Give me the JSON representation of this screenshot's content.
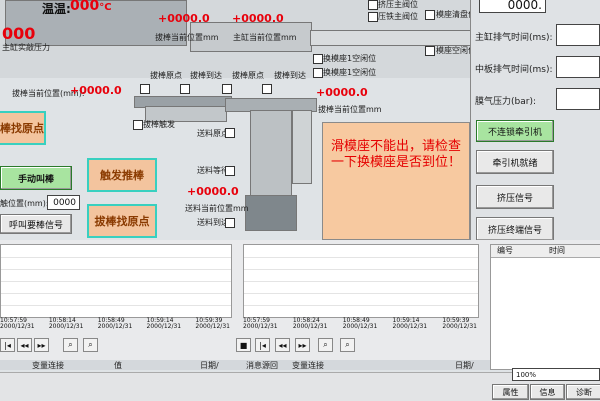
{
  "top": {
    "temp_label": "温温:",
    "temp_value": "000",
    "temp_unit": "°C",
    "red_000": "000",
    "val_a": "+0000.0",
    "val_b": "+0000.0",
    "label_pos_a": "拔棒当前位置mm",
    "label_pos_b": "主缸当前位置mm",
    "label_main_cyl": "主缸实敲压力",
    "chk1": "挤压主阀位",
    "chk2": "压铁主阀位",
    "chk3": "模座清盘位",
    "chk4": "模座空闲位",
    "chk5": "换模座1空闲位",
    "chk6": "换模座1空闲位",
    "top_right_value": "0000."
  },
  "mid": {
    "pos_label": "拔棒当前位置(mm):",
    "pos_value": "+0000.0",
    "lbl_origin": "拔棒原点",
    "lbl_arrive": "拔棒到达",
    "lbl_origin2": "拔棒原点",
    "lbl_arrive2": "拔棒到达",
    "lbl_touch": "拔棒触发",
    "lbl_feed_origin": "送料原点",
    "lbl_feed_wait": "送料等待",
    "lbl_feed_arrive": "送料到达",
    "feed_pos_value": "+0000.0",
    "feed_pos_label": "送料当前位置mm",
    "ext_value": "+0000.0",
    "ext_label": "拔棒当前位置mm"
  },
  "left_buttons": {
    "find_origin_top": "棒找原点",
    "manual": "手动叫棒",
    "pos_label": "触位置(mm):",
    "pos_value": "0000",
    "call_btn": "呼叫要棒信号",
    "trigger": "触发推棒",
    "find_origin": "拔棒找原点"
  },
  "alarm": {
    "text": "滑模座不能出，请检查一下换模座是否到位！"
  },
  "right": {
    "r1_label": "主缸排气时间(ms):",
    "r2_label": "中板排气时间(ms):",
    "r3_label": "膜气压力(bar):",
    "btn_no_link": "不连锁牵引机",
    "btn_ready": "牵引机就绪",
    "btn_signal": "挤压信号",
    "btn_end": "挤压终端信号"
  },
  "charts": {
    "left_times": [
      "10:57:59\n2000/12/31",
      "10:58:14\n2000/12/31",
      "10:58:49\n2000/12/31",
      "10:59:14\n2000/12/31",
      "10:59:39\n2000/12/31"
    ],
    "mid_times": [
      "10:57:59\n2000/12/31",
      "10:58:24\n2000/12/31",
      "10:58:49\n2000/12/31",
      "10:59:14\n2000/12/31",
      "10:59:39\n2000/12/31"
    ],
    "log_col1": "编号",
    "log_col2": "时间"
  },
  "bottom": {
    "footer_left": "变量连接",
    "footer_mid1": "消息源回",
    "footer_mid2": "变量连接",
    "footer_mid3": "值",
    "footer_right": "日期/",
    "zoom": "100%",
    "tab_prop": "属性",
    "tab_info": "信息",
    "tab_diag": "诊断"
  }
}
